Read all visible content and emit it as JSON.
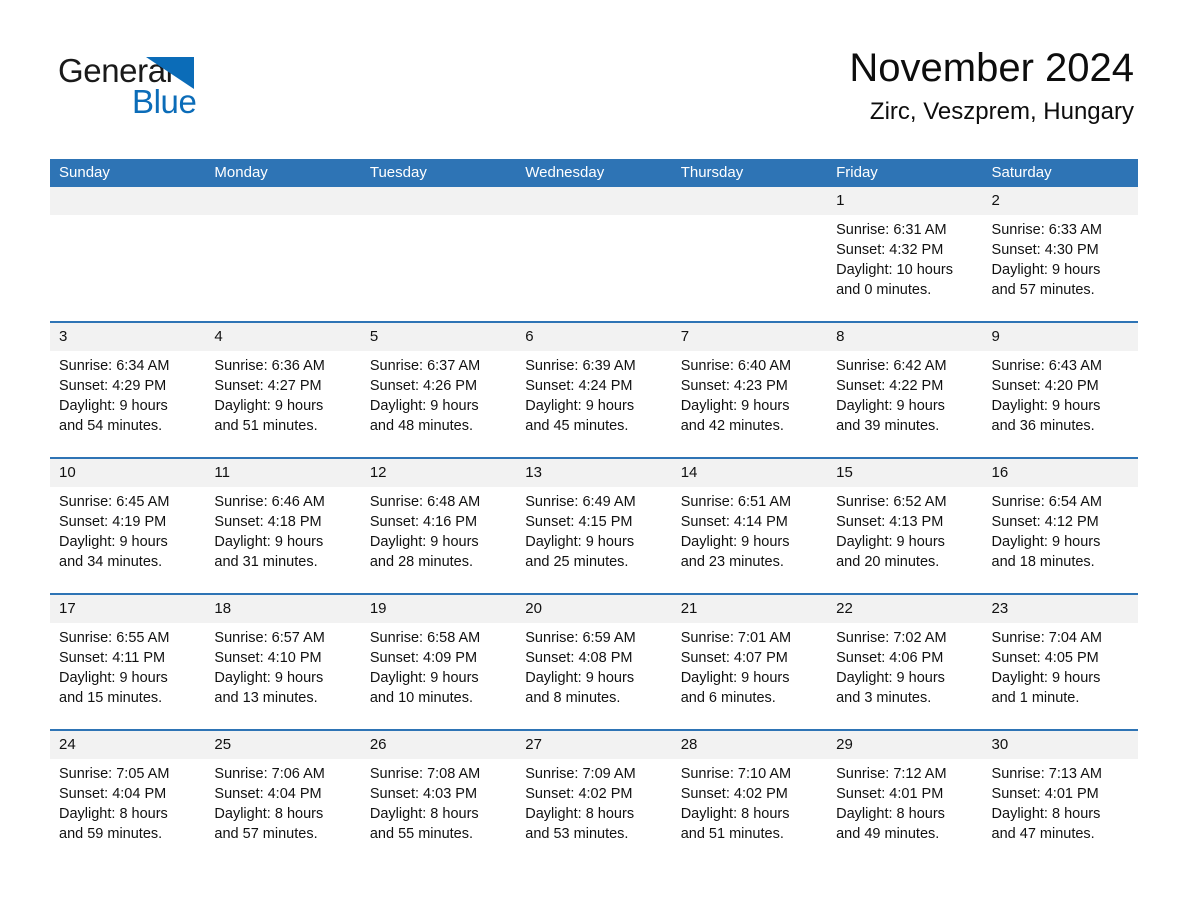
{
  "brand": {
    "word_one": "General",
    "word_two": "Blue",
    "triangle_icon": "blue-triangle-icon",
    "accent_color": "#0b6cb8"
  },
  "header": {
    "title": "November 2024",
    "subtitle": "Zirc, Veszprem, Hungary"
  },
  "theme": {
    "header_bar_color": "#2e74b5",
    "day_band_color": "#f2f2f2",
    "row_rule_color": "#2e74b5",
    "text_color": "#111111"
  },
  "weekdays": [
    "Sunday",
    "Monday",
    "Tuesday",
    "Wednesday",
    "Thursday",
    "Friday",
    "Saturday"
  ],
  "weeks": [
    [
      {
        "day": "",
        "sunrise": "",
        "sunset": "",
        "daylight_line1": "",
        "daylight_line2": ""
      },
      {
        "day": "",
        "sunrise": "",
        "sunset": "",
        "daylight_line1": "",
        "daylight_line2": ""
      },
      {
        "day": "",
        "sunrise": "",
        "sunset": "",
        "daylight_line1": "",
        "daylight_line2": ""
      },
      {
        "day": "",
        "sunrise": "",
        "sunset": "",
        "daylight_line1": "",
        "daylight_line2": ""
      },
      {
        "day": "",
        "sunrise": "",
        "sunset": "",
        "daylight_line1": "",
        "daylight_line2": ""
      },
      {
        "day": "1",
        "sunrise": "Sunrise: 6:31 AM",
        "sunset": "Sunset: 4:32 PM",
        "daylight_line1": "Daylight: 10 hours",
        "daylight_line2": "and 0 minutes."
      },
      {
        "day": "2",
        "sunrise": "Sunrise: 6:33 AM",
        "sunset": "Sunset: 4:30 PM",
        "daylight_line1": "Daylight: 9 hours",
        "daylight_line2": "and 57 minutes."
      }
    ],
    [
      {
        "day": "3",
        "sunrise": "Sunrise: 6:34 AM",
        "sunset": "Sunset: 4:29 PM",
        "daylight_line1": "Daylight: 9 hours",
        "daylight_line2": "and 54 minutes."
      },
      {
        "day": "4",
        "sunrise": "Sunrise: 6:36 AM",
        "sunset": "Sunset: 4:27 PM",
        "daylight_line1": "Daylight: 9 hours",
        "daylight_line2": "and 51 minutes."
      },
      {
        "day": "5",
        "sunrise": "Sunrise: 6:37 AM",
        "sunset": "Sunset: 4:26 PM",
        "daylight_line1": "Daylight: 9 hours",
        "daylight_line2": "and 48 minutes."
      },
      {
        "day": "6",
        "sunrise": "Sunrise: 6:39 AM",
        "sunset": "Sunset: 4:24 PM",
        "daylight_line1": "Daylight: 9 hours",
        "daylight_line2": "and 45 minutes."
      },
      {
        "day": "7",
        "sunrise": "Sunrise: 6:40 AM",
        "sunset": "Sunset: 4:23 PM",
        "daylight_line1": "Daylight: 9 hours",
        "daylight_line2": "and 42 minutes."
      },
      {
        "day": "8",
        "sunrise": "Sunrise: 6:42 AM",
        "sunset": "Sunset: 4:22 PM",
        "daylight_line1": "Daylight: 9 hours",
        "daylight_line2": "and 39 minutes."
      },
      {
        "day": "9",
        "sunrise": "Sunrise: 6:43 AM",
        "sunset": "Sunset: 4:20 PM",
        "daylight_line1": "Daylight: 9 hours",
        "daylight_line2": "and 36 minutes."
      }
    ],
    [
      {
        "day": "10",
        "sunrise": "Sunrise: 6:45 AM",
        "sunset": "Sunset: 4:19 PM",
        "daylight_line1": "Daylight: 9 hours",
        "daylight_line2": "and 34 minutes."
      },
      {
        "day": "11",
        "sunrise": "Sunrise: 6:46 AM",
        "sunset": "Sunset: 4:18 PM",
        "daylight_line1": "Daylight: 9 hours",
        "daylight_line2": "and 31 minutes."
      },
      {
        "day": "12",
        "sunrise": "Sunrise: 6:48 AM",
        "sunset": "Sunset: 4:16 PM",
        "daylight_line1": "Daylight: 9 hours",
        "daylight_line2": "and 28 minutes."
      },
      {
        "day": "13",
        "sunrise": "Sunrise: 6:49 AM",
        "sunset": "Sunset: 4:15 PM",
        "daylight_line1": "Daylight: 9 hours",
        "daylight_line2": "and 25 minutes."
      },
      {
        "day": "14",
        "sunrise": "Sunrise: 6:51 AM",
        "sunset": "Sunset: 4:14 PM",
        "daylight_line1": "Daylight: 9 hours",
        "daylight_line2": "and 23 minutes."
      },
      {
        "day": "15",
        "sunrise": "Sunrise: 6:52 AM",
        "sunset": "Sunset: 4:13 PM",
        "daylight_line1": "Daylight: 9 hours",
        "daylight_line2": "and 20 minutes."
      },
      {
        "day": "16",
        "sunrise": "Sunrise: 6:54 AM",
        "sunset": "Sunset: 4:12 PM",
        "daylight_line1": "Daylight: 9 hours",
        "daylight_line2": "and 18 minutes."
      }
    ],
    [
      {
        "day": "17",
        "sunrise": "Sunrise: 6:55 AM",
        "sunset": "Sunset: 4:11 PM",
        "daylight_line1": "Daylight: 9 hours",
        "daylight_line2": "and 15 minutes."
      },
      {
        "day": "18",
        "sunrise": "Sunrise: 6:57 AM",
        "sunset": "Sunset: 4:10 PM",
        "daylight_line1": "Daylight: 9 hours",
        "daylight_line2": "and 13 minutes."
      },
      {
        "day": "19",
        "sunrise": "Sunrise: 6:58 AM",
        "sunset": "Sunset: 4:09 PM",
        "daylight_line1": "Daylight: 9 hours",
        "daylight_line2": "and 10 minutes."
      },
      {
        "day": "20",
        "sunrise": "Sunrise: 6:59 AM",
        "sunset": "Sunset: 4:08 PM",
        "daylight_line1": "Daylight: 9 hours",
        "daylight_line2": "and 8 minutes."
      },
      {
        "day": "21",
        "sunrise": "Sunrise: 7:01 AM",
        "sunset": "Sunset: 4:07 PM",
        "daylight_line1": "Daylight: 9 hours",
        "daylight_line2": "and 6 minutes."
      },
      {
        "day": "22",
        "sunrise": "Sunrise: 7:02 AM",
        "sunset": "Sunset: 4:06 PM",
        "daylight_line1": "Daylight: 9 hours",
        "daylight_line2": "and 3 minutes."
      },
      {
        "day": "23",
        "sunrise": "Sunrise: 7:04 AM",
        "sunset": "Sunset: 4:05 PM",
        "daylight_line1": "Daylight: 9 hours",
        "daylight_line2": "and 1 minute."
      }
    ],
    [
      {
        "day": "24",
        "sunrise": "Sunrise: 7:05 AM",
        "sunset": "Sunset: 4:04 PM",
        "daylight_line1": "Daylight: 8 hours",
        "daylight_line2": "and 59 minutes."
      },
      {
        "day": "25",
        "sunrise": "Sunrise: 7:06 AM",
        "sunset": "Sunset: 4:04 PM",
        "daylight_line1": "Daylight: 8 hours",
        "daylight_line2": "and 57 minutes."
      },
      {
        "day": "26",
        "sunrise": "Sunrise: 7:08 AM",
        "sunset": "Sunset: 4:03 PM",
        "daylight_line1": "Daylight: 8 hours",
        "daylight_line2": "and 55 minutes."
      },
      {
        "day": "27",
        "sunrise": "Sunrise: 7:09 AM",
        "sunset": "Sunset: 4:02 PM",
        "daylight_line1": "Daylight: 8 hours",
        "daylight_line2": "and 53 minutes."
      },
      {
        "day": "28",
        "sunrise": "Sunrise: 7:10 AM",
        "sunset": "Sunset: 4:02 PM",
        "daylight_line1": "Daylight: 8 hours",
        "daylight_line2": "and 51 minutes."
      },
      {
        "day": "29",
        "sunrise": "Sunrise: 7:12 AM",
        "sunset": "Sunset: 4:01 PM",
        "daylight_line1": "Daylight: 8 hours",
        "daylight_line2": "and 49 minutes."
      },
      {
        "day": "30",
        "sunrise": "Sunrise: 7:13 AM",
        "sunset": "Sunset: 4:01 PM",
        "daylight_line1": "Daylight: 8 hours",
        "daylight_line2": "and 47 minutes."
      }
    ]
  ]
}
